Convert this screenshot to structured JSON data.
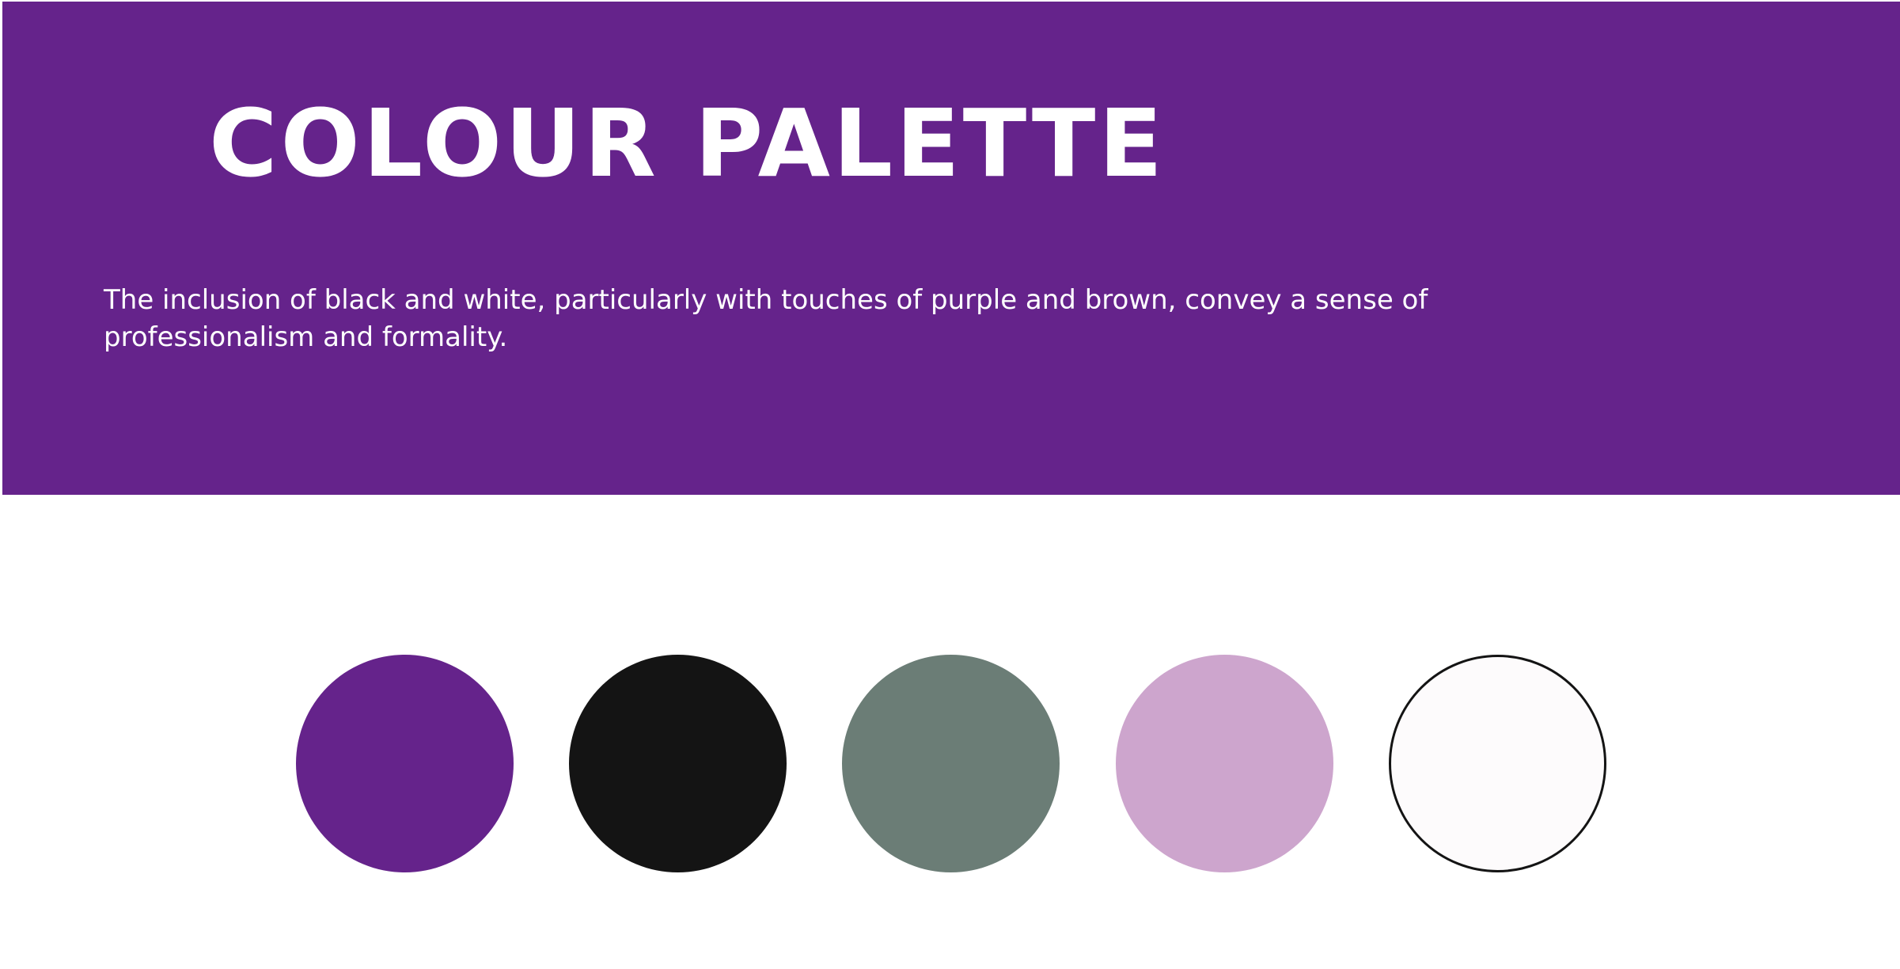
{
  "header": {
    "title": "COLOUR PALETTE",
    "description": "The inclusion of black and white, particularly with touches of purple and brown, convey a sense of professionalism and formality."
  },
  "banner_color": "#65238b",
  "palette": [
    {
      "name": "purple",
      "color": "#65238b"
    },
    {
      "name": "black",
      "color": "#141414"
    },
    {
      "name": "grey-green",
      "color": "#6b7d76"
    },
    {
      "name": "lilac",
      "color": "#cda5cd"
    },
    {
      "name": "off-white",
      "color": "#fdfbfc"
    }
  ]
}
